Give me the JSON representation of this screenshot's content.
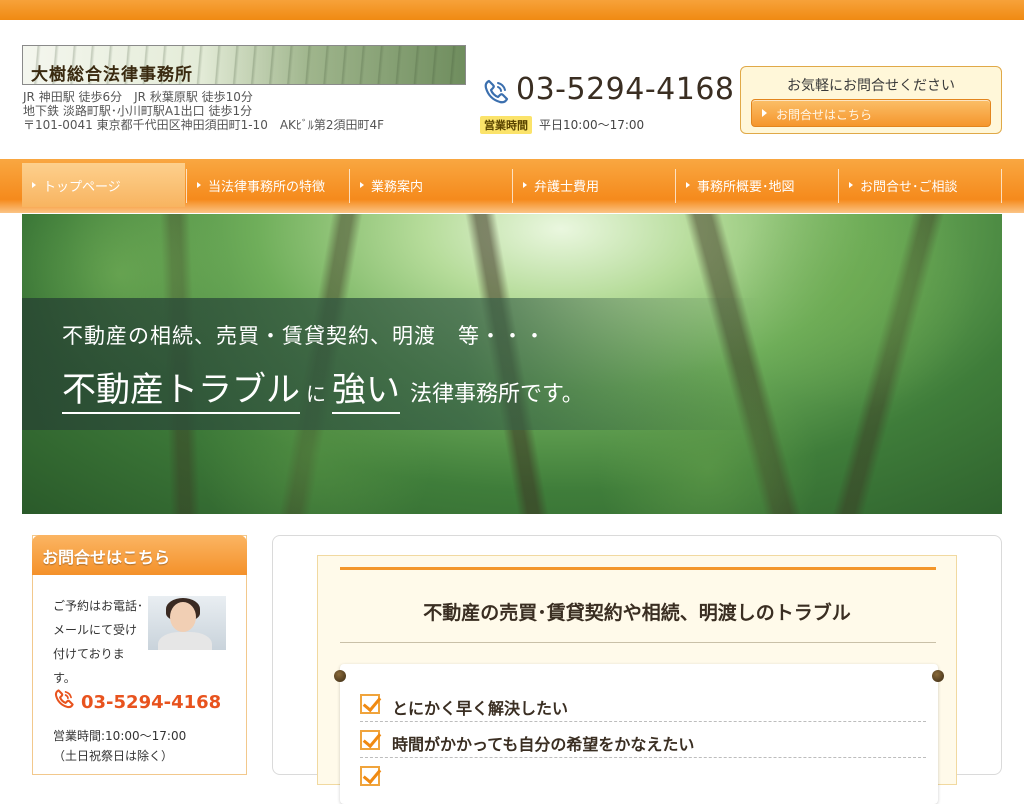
{
  "header": {
    "logo_text": "大樹総合法律事務所",
    "address_lines": [
      "JR 神田駅 徒歩6分　JR 秋葉原駅 徒歩10分",
      "地下鉄 淡路町駅･小川町駅A1出口 徒歩1分",
      "〒101-0041 東京都千代田区神田須田町1-10　AKﾋﾞﾙ第2須田町4F"
    ],
    "phone": "03-5294-4168",
    "hours_label": "営業時間",
    "hours": "平日10:00～17:00",
    "contact_caption": "お気軽にお問合せください",
    "contact_button": "お問合せはこちら"
  },
  "nav": {
    "items": [
      {
        "label": "トップページ"
      },
      {
        "label": "当法律事務所の特徴"
      },
      {
        "label": "業務案内"
      },
      {
        "label": "弁護士費用"
      },
      {
        "label": "事務所概要･地図"
      },
      {
        "label": "お問合せ･ご相談"
      }
    ]
  },
  "hero": {
    "line1": "不動産の相続、売買・賃貸契約、明渡　等・・・",
    "line2_big1": "不動産トラブル",
    "line2_small": "に",
    "line2_big2": "強い",
    "line2_rest": "法律事務所です。"
  },
  "sidebar": {
    "title": "お問合せはこちら",
    "text": "ご予約はお電話･メールにて受け付けております。",
    "phone": "03-5294-4168",
    "hours_line1": "営業時間:10:00～17:00",
    "hours_line2": "（土日祝祭日は除く）"
  },
  "main": {
    "heading": "不動産の売買･賃貸契約や相続、明渡しのトラブル",
    "checklist": [
      "とにかく早く解決したい",
      "時間がかかっても自分の希望をかなえたい"
    ]
  },
  "colors": {
    "accent_orange": "#f58a1c",
    "phone_red": "#e8531e",
    "hours_tag": "#fbe36a"
  }
}
